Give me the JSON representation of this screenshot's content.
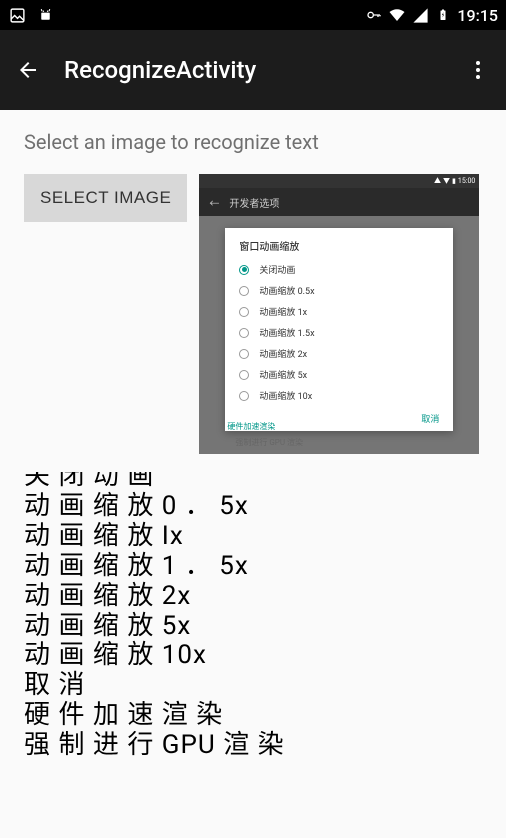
{
  "status_bar": {
    "time": "19:15"
  },
  "app_bar": {
    "title": "RecognizeActivity"
  },
  "content": {
    "subtitle": "Select an image to recognize text",
    "select_button": "SELECT IMAGE"
  },
  "preview": {
    "status_time": "15:00",
    "header_title": "开发者选项",
    "dialog_title": "窗口动画缩放",
    "options": {
      "o0": "关闭动画",
      "o1": "动画缩放 0.5x",
      "o2": "动画缩放 1x",
      "o3": "动画缩放 1.5x",
      "o4": "动画缩放 2x",
      "o5": "动画缩放 5x",
      "o6": "动画缩放 10x"
    },
    "cancel": "取消",
    "bottom_text1": "硬件加速渲染",
    "bottom_text2": "强制进行 GPU 渲染"
  },
  "results": {
    "r0": "关 闭 动 画",
    "r1": "动 画 缩 放 0 ． 5x",
    "r2": "动 画 缩 放 Ix",
    "r3": "动 画 缩 放 1 ． 5x",
    "r4": "动 画 缩 放 2x",
    "r5": "动 画 缩 放 5x",
    "r6": "动 画 缩 放 10x",
    "r7": "取 消",
    "r8": "硬 件 加 速 渲 染",
    "r9": "强 制 进 行 GPU 渲 染"
  }
}
